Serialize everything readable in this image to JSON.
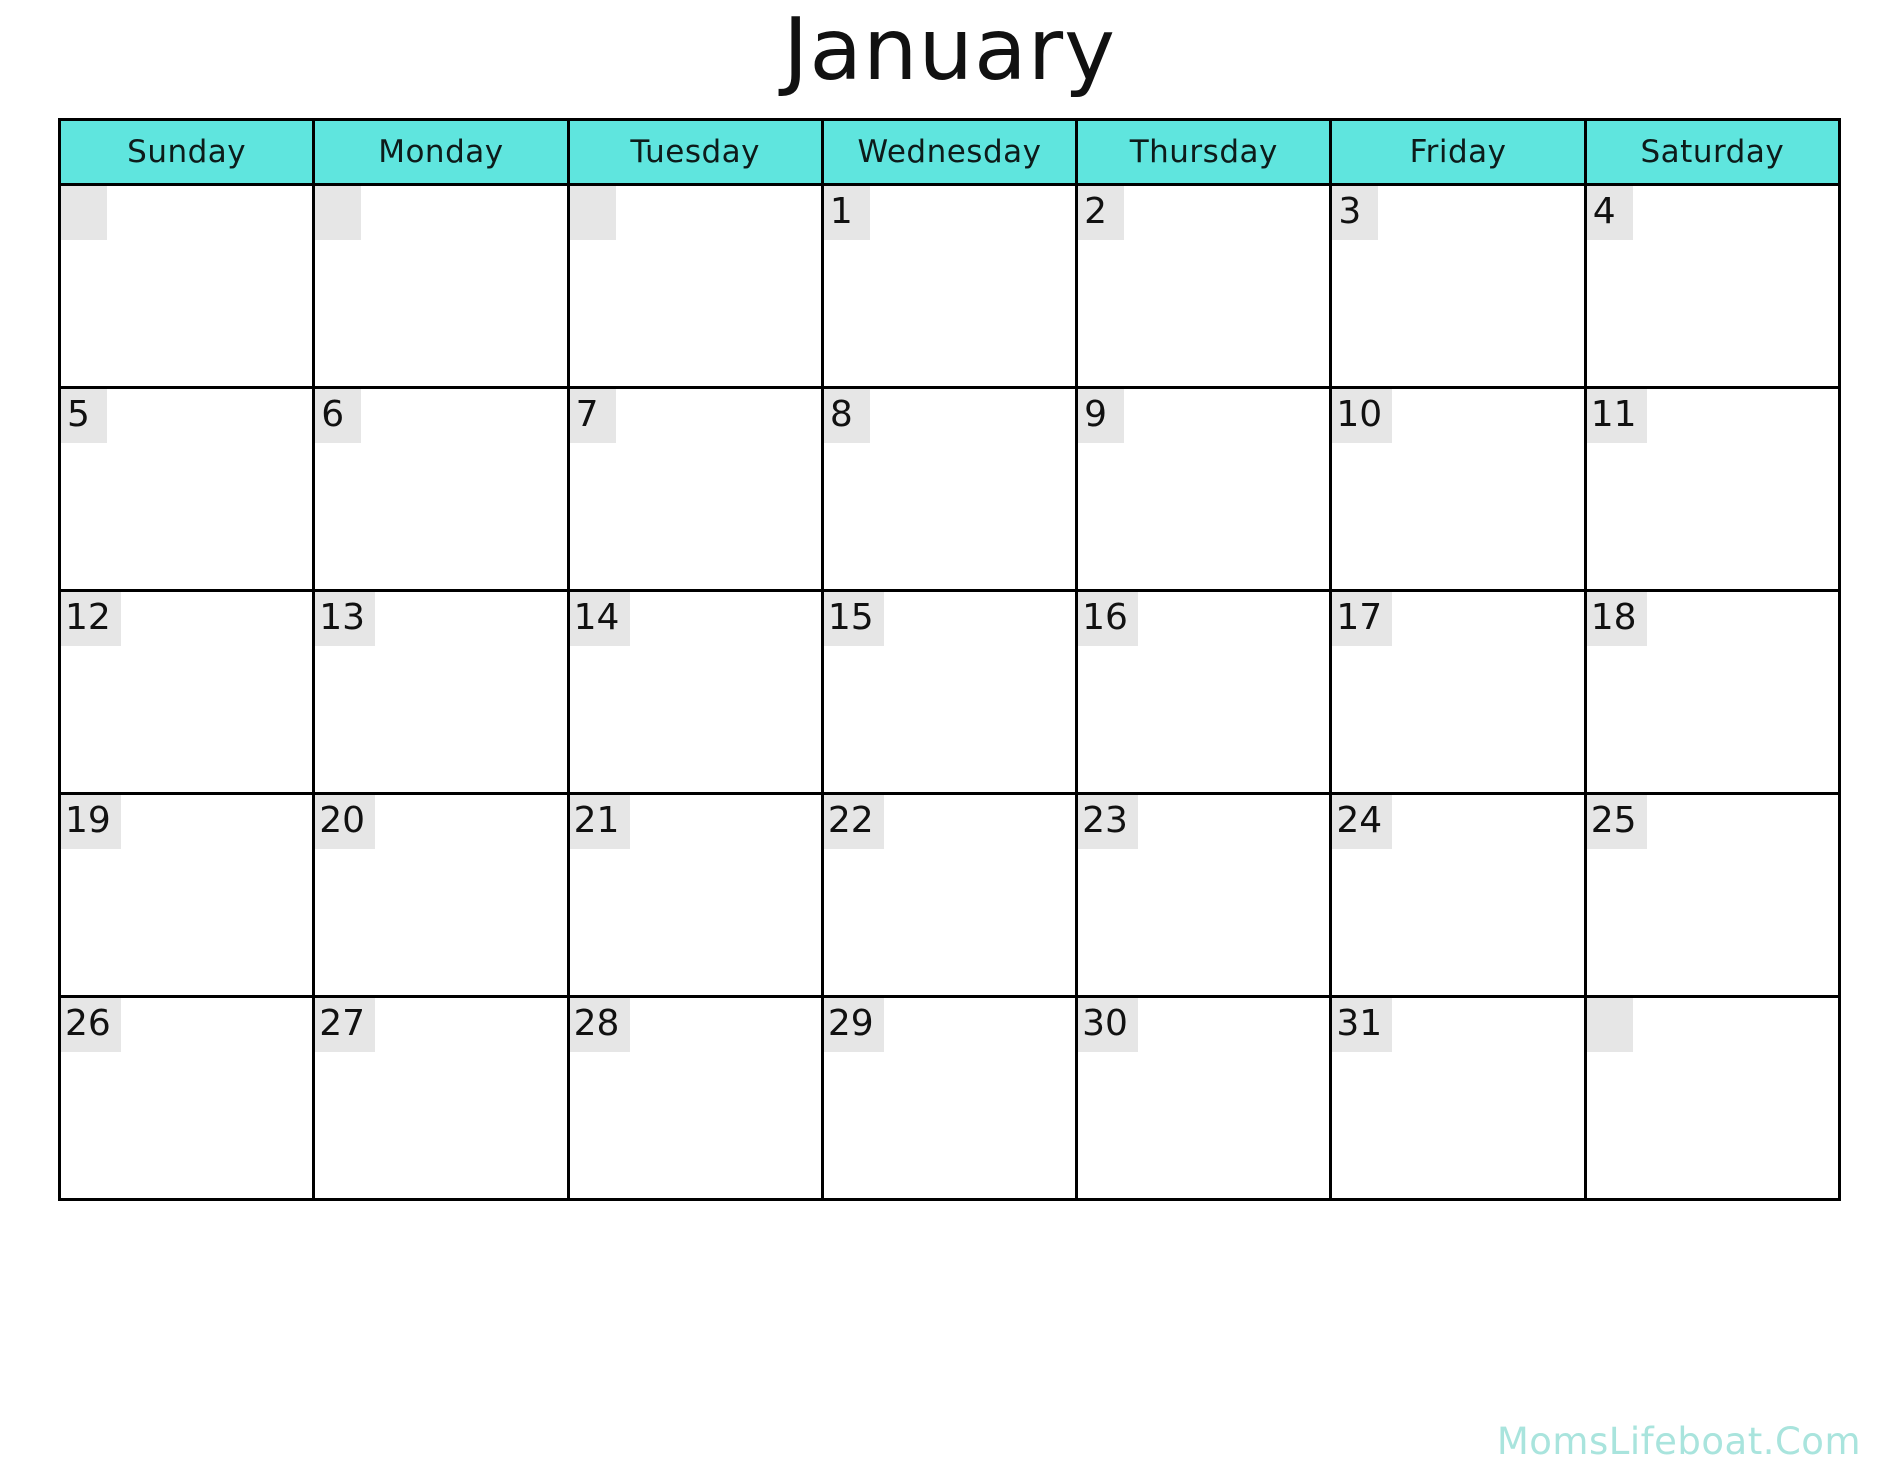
{
  "title": "January",
  "weekdays": [
    "Sunday",
    "Monday",
    "Tuesday",
    "Wednesday",
    "Thursday",
    "Friday",
    "Saturday"
  ],
  "weeks": [
    [
      "",
      "",
      "",
      "1",
      "2",
      "3",
      "4"
    ],
    [
      "5",
      "6",
      "7",
      "8",
      "9",
      "10",
      "11"
    ],
    [
      "12",
      "13",
      "14",
      "15",
      "16",
      "17",
      "18"
    ],
    [
      "19",
      "20",
      "21",
      "22",
      "23",
      "24",
      "25"
    ],
    [
      "26",
      "27",
      "28",
      "29",
      "30",
      "31",
      ""
    ]
  ],
  "watermark": "MomsLifeboat.Com",
  "colors": {
    "header_teal": "#5FE5DE",
    "daynum_box": "#E6E6E6",
    "grid_line": "#000000",
    "text": "#111111",
    "watermark": "#a9e4dd",
    "page_background": "#ffffff"
  }
}
